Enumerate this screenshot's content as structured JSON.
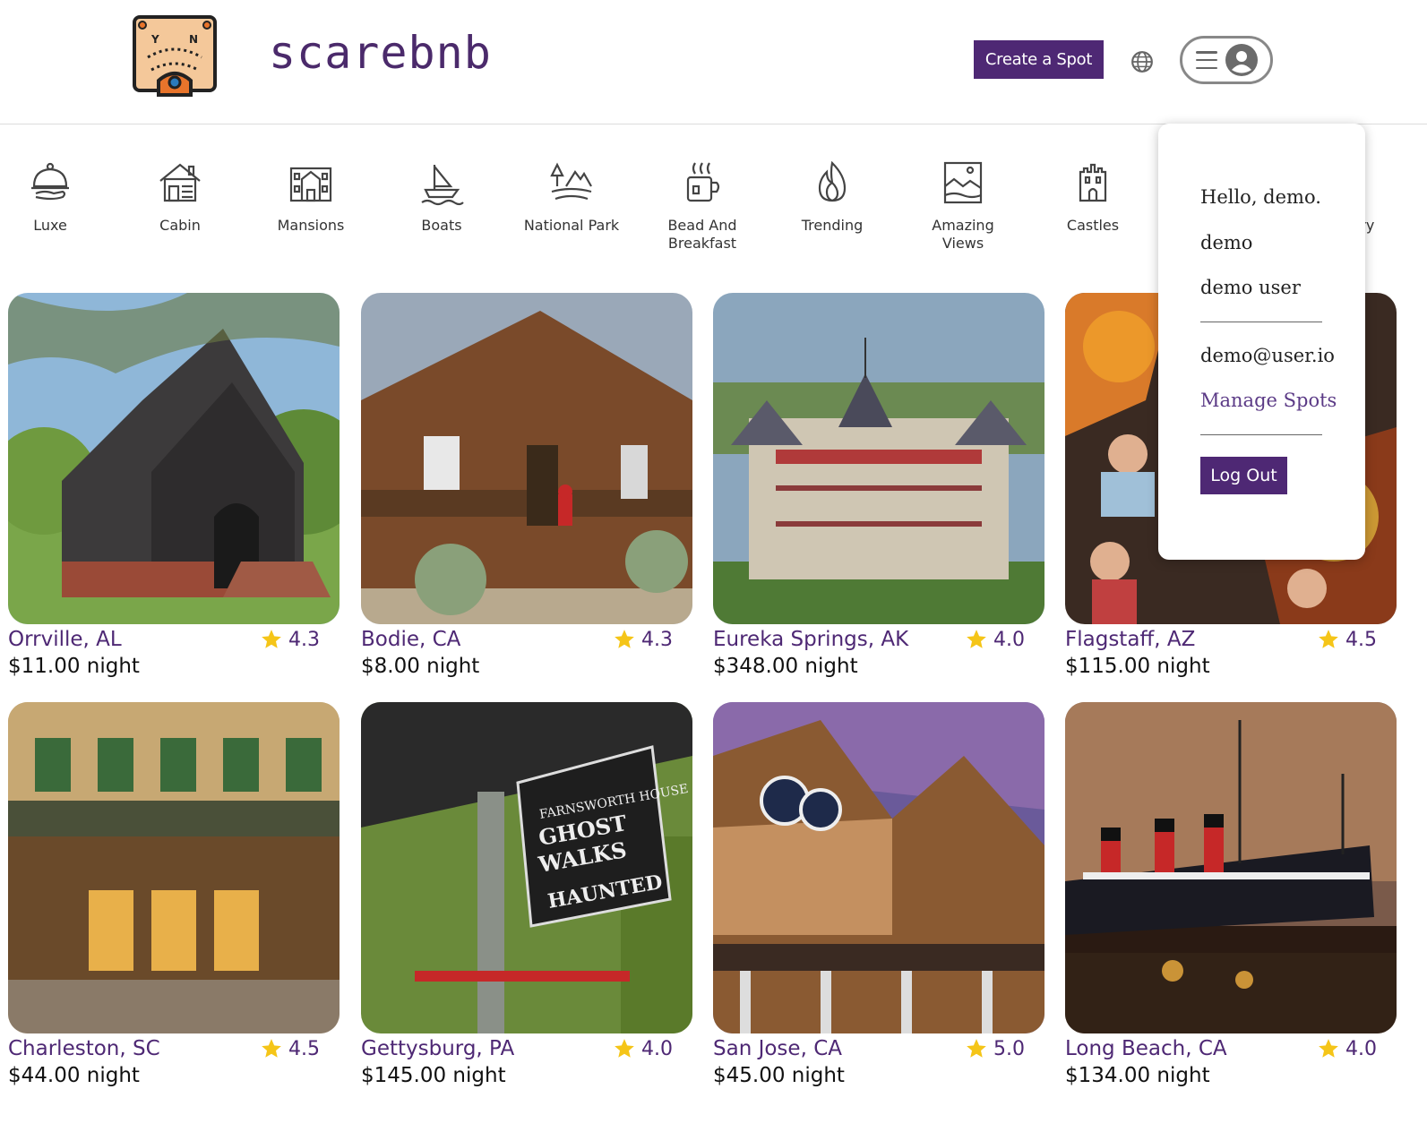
{
  "brand": {
    "name": "scarebnb",
    "logo": "ouija-board-logo"
  },
  "header": {
    "create_label": "Create a Spot",
    "globe_icon": "globe-icon",
    "menu_icon": "hamburger-icon",
    "avatar_icon": "user-avatar-icon"
  },
  "categories": [
    {
      "label": "Luxe",
      "icon": "cloche-icon"
    },
    {
      "label": "Cabin",
      "icon": "cabin-icon"
    },
    {
      "label": "Mansions",
      "icon": "mansion-icon"
    },
    {
      "label": "Boats",
      "icon": "boat-icon"
    },
    {
      "label": "National Park",
      "icon": "national-park-icon"
    },
    {
      "label": "Bead And Breakfast",
      "icon": "coffee-cup-icon"
    },
    {
      "label": "Trending",
      "icon": "flame-icon"
    },
    {
      "label": "Amazing Views",
      "icon": "picture-icon"
    },
    {
      "label": "Castles",
      "icon": "castle-icon"
    },
    {
      "label": "try",
      "icon": "partial-icon"
    }
  ],
  "spots": [
    {
      "city": "Orrville, AL",
      "rating": "4.3",
      "price": "$11.00 night"
    },
    {
      "city": "Bodie, CA",
      "rating": "4.3",
      "price": "$8.00 night"
    },
    {
      "city": "Eureka Springs, AK",
      "rating": "4.0",
      "price": "$348.00 night"
    },
    {
      "city": "Flagstaff, AZ",
      "rating": "4.5",
      "price": "$115.00 night"
    },
    {
      "city": "Charleston, SC",
      "rating": "4.5",
      "price": "$44.00 night"
    },
    {
      "city": "Gettysburg, PA",
      "rating": "4.0",
      "price": "$145.00 night"
    },
    {
      "city": "San Jose, CA",
      "rating": "5.0",
      "price": "$45.00 night"
    },
    {
      "city": "Long Beach, CA",
      "rating": "4.0",
      "price": "$134.00 night"
    }
  ],
  "colors": {
    "accent": "#4e2874",
    "star": "#f5c518"
  },
  "dropdown": {
    "greeting": "Hello, demo.",
    "username": "demo",
    "fullname": "demo user",
    "email": "demo@user.io",
    "manage_label": "Manage Spots",
    "logout_label": "Log Out"
  }
}
